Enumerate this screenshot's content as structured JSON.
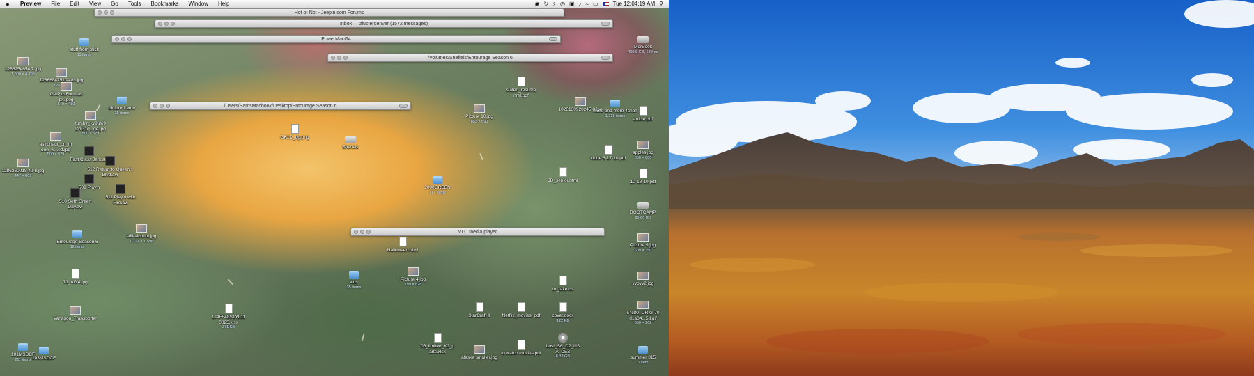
{
  "menubar": {
    "app": "Preview",
    "items": [
      "File",
      "Edit",
      "View",
      "Go",
      "Tools",
      "Bookmarks",
      "Window",
      "Help"
    ],
    "clock": "Tue 12:04:19 AM"
  },
  "windows": [
    {
      "title": "Hot or Not - Jeepin.com Forums"
    },
    {
      "title": "Inbox — zlusterdenver (1572 messages)"
    },
    {
      "title": "PowerMacG4"
    },
    {
      "title": "/Volumes/Sneffels/Entourage Season 6"
    },
    {
      "title": "/Users/SamsMacbook/Desktop/Entourage Season 6"
    },
    {
      "title": "VLC media player"
    }
  ],
  "icons": [
    {
      "label": "stuff from stick",
      "sub": "11 items",
      "type": "folder"
    },
    {
      "label": "1286254654 7.jpg",
      "sub": "1,000 × 4,795",
      "type": "pic"
    },
    {
      "label": "128668475104 8s.jpg",
      "sub": "126 × 95",
      "type": "pic"
    },
    {
      "label": "GetPicsForm.as px.jpeg",
      "sub": "640 × 480",
      "type": "pic"
    },
    {
      "label": "picture frame",
      "sub": "35 items",
      "type": "folder"
    },
    {
      "label": "tumblr_kv9ulo9 DhG1q...ge.jpg",
      "sub": "500 × 579",
      "type": "pic"
    },
    {
      "label": "astronaut_on_m oon_w...ed.jpg",
      "sub": "500 × 579",
      "type": "pic"
    },
    {
      "label": "First Class Jerk.avi",
      "sub": "",
      "type": "movie"
    },
    {
      "label": "512 Return to Queen's Blvd.avi",
      "sub": "",
      "type": "movie"
    },
    {
      "label": "1286260918 42 6.jpg",
      "sub": "447 × 609",
      "type": "pic"
    },
    {
      "label": "509 Play'n",
      "sub": "",
      "type": "movie"
    },
    {
      "label": "511 Play'n with Fire.avi",
      "sub": "",
      "type": "movie"
    },
    {
      "label": "510 Seth Green Day.avi",
      "sub": "",
      "type": "movie"
    },
    {
      "label": "Entourage Season 6",
      "sub": "12 items",
      "type": "folder"
    },
    {
      "label": "still-alcohol.jpg",
      "sub": "1,127 × 1,596",
      "type": "pic"
    },
    {
      "label": "T1_AW4.jpg",
      "sub": "",
      "type": "doc"
    },
    {
      "label": "1J4FF48S1YL11 0825.xlsx",
      "sub": "371 KB",
      "type": "doc"
    },
    {
      "label": "Vanagon_Transporter",
      "sub": "",
      "type": "pic"
    },
    {
      "label": "101MSDCF",
      "sub": "211 items",
      "type": "folder"
    },
    {
      "label": "103MSDCF",
      "sub": "",
      "type": "folder"
    },
    {
      "label": "StarCraft II",
      "sub": "",
      "type": "doc"
    },
    {
      "label": "06_limited_KJ_p arts.xlsx",
      "sub": "",
      "type": "doc"
    },
    {
      "label": "alaska smaller.jpg",
      "sub": "",
      "type": "pic"
    },
    {
      "label": "to watch movies.pdf",
      "sub": "",
      "type": "doc"
    },
    {
      "label": "Netflix_movies. pdf",
      "sub": "",
      "type": "doc"
    },
    {
      "label": "cover.docx",
      "sub": "122 KB",
      "type": "doc"
    },
    {
      "label": "Lost_S6_D2_US A_DES",
      "sub": "6.32 GB",
      "type": "dvd"
    },
    {
      "label": "to_take.txt",
      "sub": "",
      "type": "doc"
    },
    {
      "label": "Picture 10.jpg",
      "sub": "853 × 690",
      "type": "pic"
    },
    {
      "label": "slaten_resume nrel.pdf",
      "sub": "",
      "type": "doc"
    },
    {
      "label": "1028130920245 8.jpg",
      "sub": "",
      "type": "pic"
    },
    {
      "label": "more and more 4chan",
      "sub": "1,318 items",
      "type": "folder"
    },
    {
      "label": "klode 6-17-10.pdf",
      "sub": "",
      "type": "doc"
    },
    {
      "label": "JD_senior.html",
      "sub": "",
      "type": "doc"
    },
    {
      "label": "2000GREEN",
      "sub": "117 items",
      "type": "folder"
    },
    {
      "label": "Halloween.html",
      "sub": "",
      "type": "doc"
    },
    {
      "label": "Picture 4.jpg",
      "sub": "799 × 628",
      "type": "pic"
    },
    {
      "label": "vids",
      "sub": "35 items",
      "type": "folder"
    },
    {
      "label": "MorBook",
      "sub": "499.8 GB, 58 free",
      "type": "disk"
    },
    {
      "label": "article.pdf",
      "sub": "",
      "type": "doc"
    },
    {
      "label": "apples.jpg",
      "sub": "800 × 600",
      "type": "pic"
    },
    {
      "label": "10-18-10.pdf",
      "sub": "",
      "type": "doc"
    },
    {
      "label": "BOOTCAMP",
      "sub": "95.66 GB",
      "type": "disk"
    },
    {
      "label": "Picture 9.jpg",
      "sub": "609 × 350",
      "type": "pic"
    },
    {
      "label": "vvovv2.jpg",
      "sub": "",
      "type": "pic"
    },
    {
      "label": "c7c80_ORIG-70 d1a84...5d.gif",
      "sub": "350 × 262",
      "type": "pic"
    },
    {
      "label": "summer 315",
      "sub": "1 item",
      "type": "folder"
    },
    {
      "label": "Sheffels",
      "sub": "",
      "type": "disk"
    },
    {
      "label": "GK1D_bg.png",
      "sub": "",
      "type": "doc"
    }
  ]
}
